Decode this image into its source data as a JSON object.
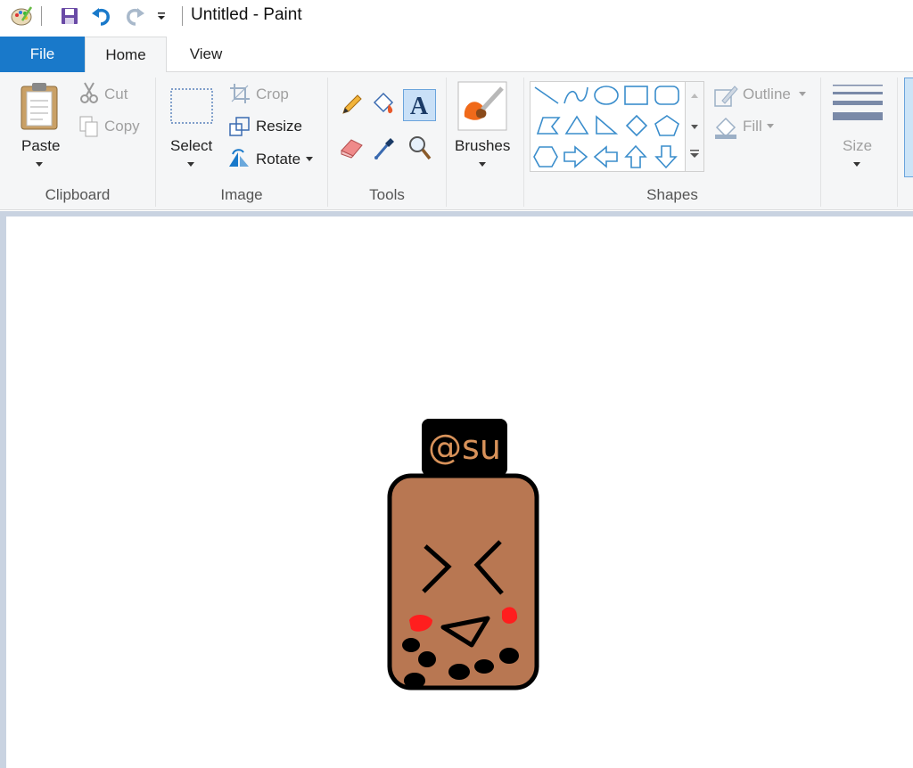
{
  "window": {
    "title": "Untitled - Paint"
  },
  "tabs": [
    {
      "label": "File"
    },
    {
      "label": "Home"
    },
    {
      "label": "View"
    }
  ],
  "ribbon": {
    "clipboard": {
      "group_label": "Clipboard",
      "paste": "Paste",
      "cut": "Cut",
      "copy": "Copy"
    },
    "image": {
      "group_label": "Image",
      "select": "Select",
      "crop": "Crop",
      "resize": "Resize",
      "rotate": "Rotate"
    },
    "tools": {
      "group_label": "Tools"
    },
    "brushes": {
      "label": "Brushes"
    },
    "shapes": {
      "group_label": "Shapes",
      "outline": "Outline",
      "fill": "Fill"
    },
    "size": {
      "label": "Size"
    }
  },
  "canvas": {
    "drawing_text": "@su",
    "colors": {
      "bottle": "#b87752",
      "cap": "#000000",
      "cap_text": "#d8925a",
      "blush": "#ff1e1e"
    }
  },
  "colors": {
    "accent": "#1979ca",
    "ribbon_bg": "#f5f6f7",
    "workspace": "#c9d3e1",
    "shape_stroke": "#3a8dcc"
  }
}
